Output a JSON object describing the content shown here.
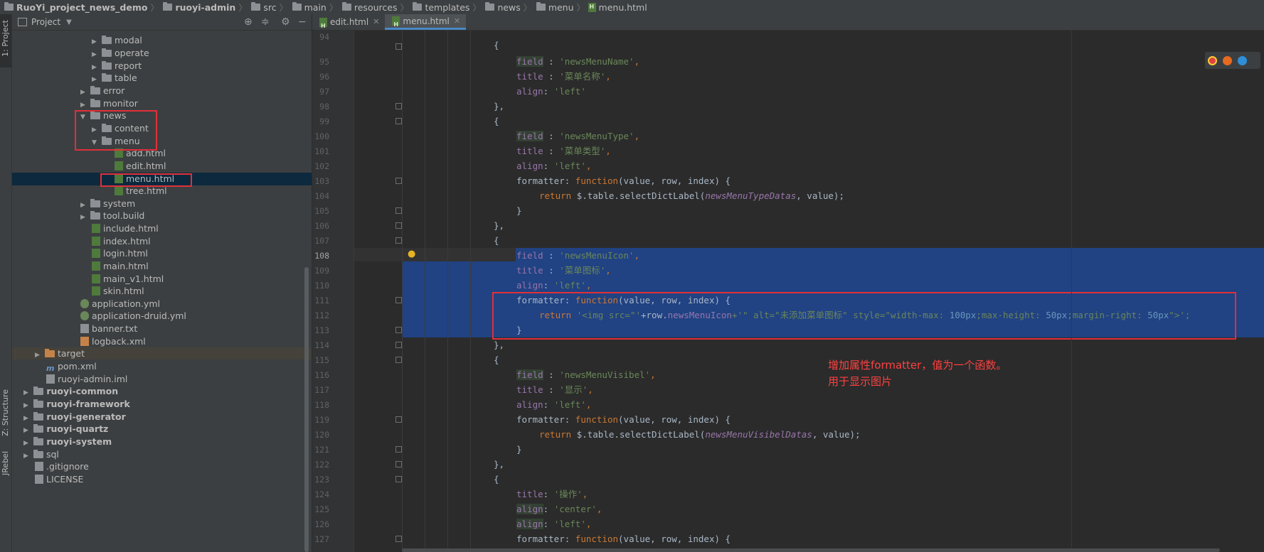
{
  "breadcrumb": [
    "RuoYi_project_news_demo",
    "ruoyi-admin",
    "src",
    "main",
    "resources",
    "templates",
    "news",
    "menu",
    "menu.html"
  ],
  "left_strip": {
    "project_label": "1: Project",
    "structure_label": "Z: Structure",
    "jrebel_label": "JRebel"
  },
  "project_panel": {
    "title": "Project"
  },
  "tree": [
    {
      "label": "modal",
      "kind": "folder"
    },
    {
      "label": "operate",
      "kind": "folder"
    },
    {
      "label": "report",
      "kind": "folder"
    },
    {
      "label": "table",
      "kind": "folder"
    },
    {
      "label": "error",
      "kind": "folder"
    },
    {
      "label": "monitor",
      "kind": "folder"
    },
    {
      "label": "news",
      "kind": "folder"
    },
    {
      "label": "content",
      "kind": "folder"
    },
    {
      "label": "menu",
      "kind": "folder"
    },
    {
      "label": "add.html",
      "kind": "html"
    },
    {
      "label": "edit.html",
      "kind": "html"
    },
    {
      "label": "menu.html",
      "kind": "html"
    },
    {
      "label": "tree.html",
      "kind": "html"
    },
    {
      "label": "system",
      "kind": "folder"
    },
    {
      "label": "tool.build",
      "kind": "folder"
    },
    {
      "label": "include.html",
      "kind": "html"
    },
    {
      "label": "index.html",
      "kind": "html"
    },
    {
      "label": "login.html",
      "kind": "html"
    },
    {
      "label": "main.html",
      "kind": "html"
    },
    {
      "label": "main_v1.html",
      "kind": "html"
    },
    {
      "label": "skin.html",
      "kind": "html"
    },
    {
      "label": "application.yml",
      "kind": "yml"
    },
    {
      "label": "application-druid.yml",
      "kind": "yml"
    },
    {
      "label": "banner.txt",
      "kind": "txt"
    },
    {
      "label": "logback.xml",
      "kind": "xml"
    },
    {
      "label": "target",
      "kind": "folder"
    },
    {
      "label": "pom.xml",
      "kind": "pom"
    },
    {
      "label": "ruoyi-admin.iml",
      "kind": "iml"
    },
    {
      "label": "ruoyi-common",
      "kind": "module"
    },
    {
      "label": "ruoyi-framework",
      "kind": "module"
    },
    {
      "label": "ruoyi-generator",
      "kind": "module"
    },
    {
      "label": "ruoyi-quartz",
      "kind": "module"
    },
    {
      "label": "ruoyi-system",
      "kind": "module"
    },
    {
      "label": "sql",
      "kind": "folder"
    },
    {
      "label": ".gitignore",
      "kind": "file"
    },
    {
      "label": "LICENSE",
      "kind": "file"
    }
  ],
  "tabs": [
    {
      "label": "edit.html"
    },
    {
      "label": "menu.html"
    }
  ],
  "line_numbers": [
    "94",
    "95",
    "96",
    "97",
    "98",
    "99",
    "100",
    "101",
    "102",
    "103",
    "104",
    "105",
    "106",
    "107",
    "108",
    "109",
    "110",
    "111",
    "112",
    "113",
    "114",
    "115",
    "116",
    "117",
    "118",
    "119",
    "120",
    "121",
    "122",
    "123",
    "124",
    "125",
    "126",
    "127"
  ],
  "code": {
    "l94": "{",
    "l95_key": "field",
    "l95_val": "'newsMenuName'",
    "l96_key": "title",
    "l96_val": "'菜单名称'",
    "l97_key": "align",
    "l97_val": "'left'",
    "l98": "},",
    "l99": "{",
    "l100_key": "field",
    "l100_val": "'newsMenuType'",
    "l101_key": "title",
    "l101_val": "'菜单类型'",
    "l102_key": "align",
    "l102_val": "'left'",
    "l103_key": "formatter",
    "l103_fn": "function",
    "l103_args": "(value, row, index) {",
    "l104_ret": "return",
    "l104_a": "$.table.selectDictLabel(",
    "l104_b": "newsMenuTypeDatas",
    "l104_c": ", value);",
    "l105": "}",
    "l106": "},",
    "l107": "{",
    "l108_key": "field",
    "l108_val": "'newsMenuIcon'",
    "l109_key": "title",
    "l109_val": "'菜单图标'",
    "l110_key": "align",
    "l110_val": "'left'",
    "l111_key": "formatter",
    "l111_fn": "function",
    "l111_args": "(value, row, index) {",
    "l112_ret": "return",
    "l112_a": "'<img src=\"'",
    "l112_b": "+row.",
    "l112_c": "newsMenuIcon",
    "l112_d": "+'\" alt=\"未添加菜单图标\" style=\"width-max: ",
    "l112_e": "100px",
    "l112_f": ";max-height: ",
    "l112_g": "50px",
    "l112_h": ";margin-right: ",
    "l112_i": "50px",
    "l112_j": "\">';",
    "l113": "}",
    "l114": "},",
    "l115": "{",
    "l116_key": "field",
    "l116_val": "'newsMenuVisibel'",
    "l117_key": "title",
    "l117_val": "'显示'",
    "l118_key": "align",
    "l118_val": "'left'",
    "l119_key": "formatter",
    "l119_fn": "function",
    "l119_args": "(value, row, index) {",
    "l120_ret": "return",
    "l120_a": "$.table.selectDictLabel(",
    "l120_b": "newsMenuVisibelDatas",
    "l120_c": ", value);",
    "l121": "}",
    "l122": "},",
    "l123": "{",
    "l124_key": "title",
    "l124_val": "'操作'",
    "l125_key": "align",
    "l125_val": "'center'",
    "l126_key": "align",
    "l126_val": "'left'",
    "l127_key": "formatter",
    "l127_fn": "function",
    "l127_args": "(value, row, index) {"
  },
  "annotation": {
    "line1": "增加属性formatter，值为一个函数。",
    "line2": "用于显示图片"
  },
  "colors": {
    "accent": "#4a88c7",
    "selection": "#214283",
    "highlight_box": "#e0303a"
  },
  "browser_icons": [
    "chrome-icon",
    "firefox-icon",
    "safari-icon"
  ]
}
